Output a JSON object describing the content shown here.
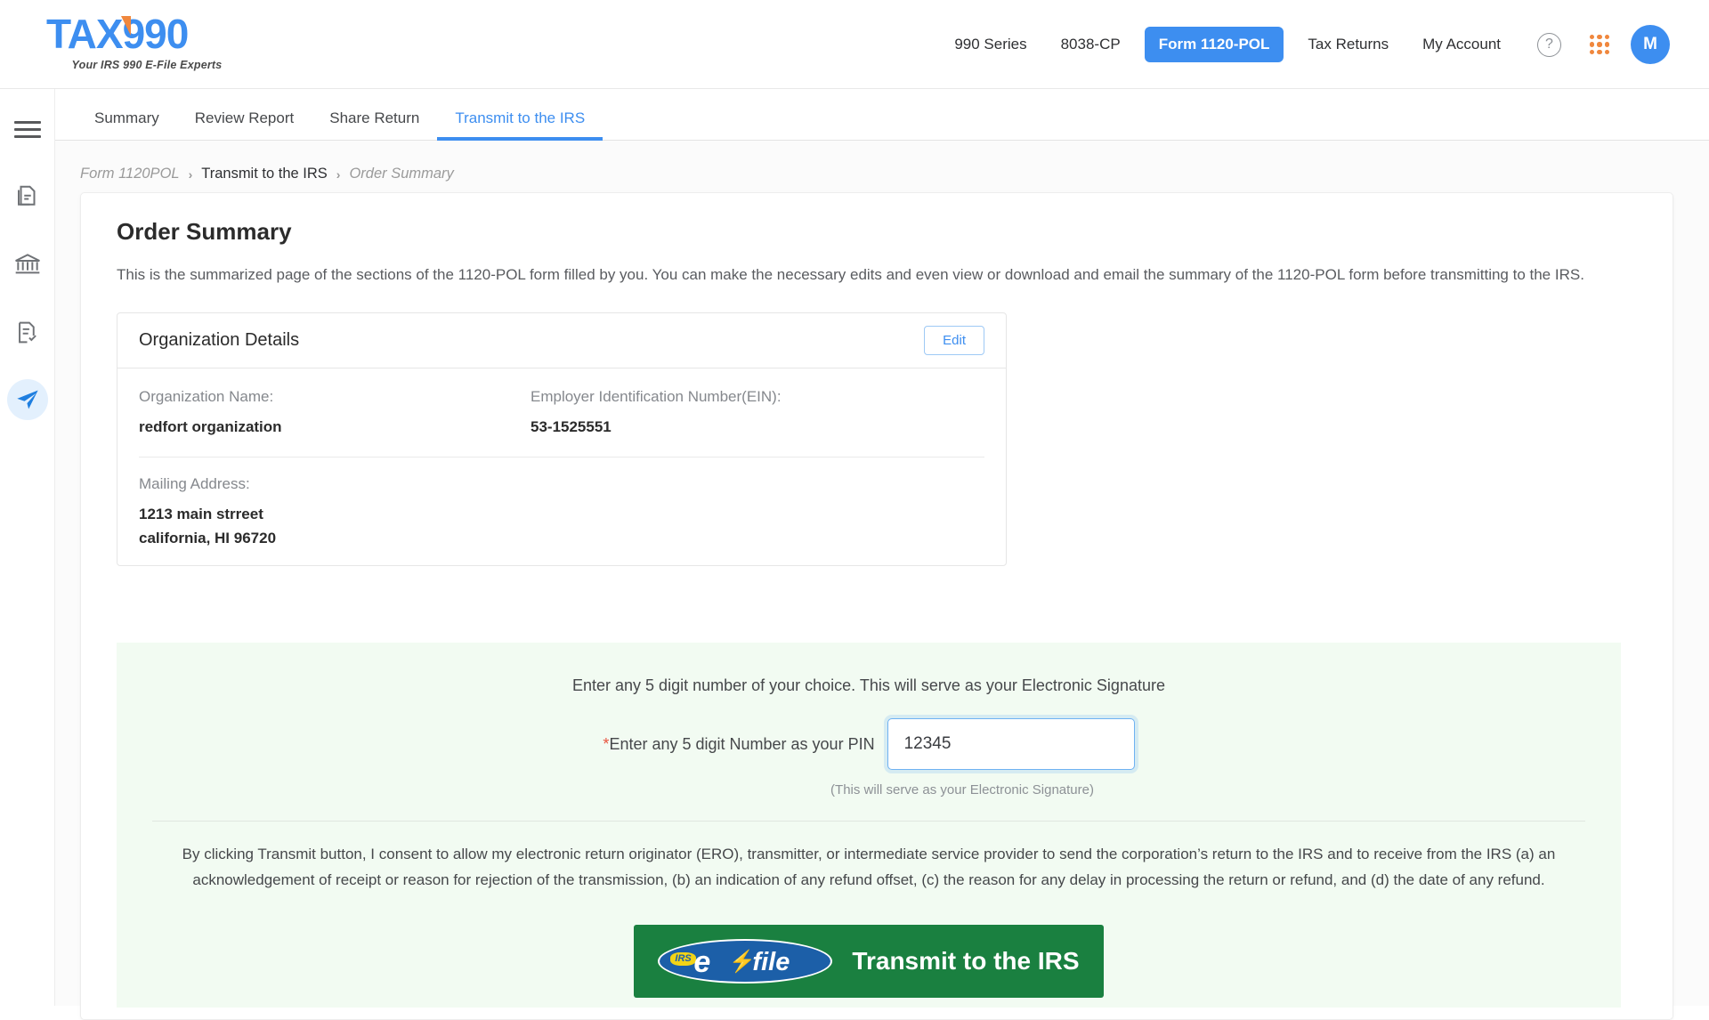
{
  "brand": {
    "logo_text": "TAX990",
    "logo_tagline": "Your IRS 990 E-File Experts"
  },
  "header": {
    "nav": [
      {
        "label": "990 Series",
        "active": false
      },
      {
        "label": "8038-CP",
        "active": false
      },
      {
        "label": "Form 1120-POL",
        "active": true
      },
      {
        "label": "Tax Returns",
        "active": false
      },
      {
        "label": "My Account",
        "active": false
      }
    ],
    "help_icon": "question-mark-circle-icon",
    "apps_icon": "apps-grid-icon",
    "avatar_initial": "M",
    "accent_blue": "#3d8ef0",
    "accent_orange": "#f0873d"
  },
  "sidebar": {
    "items": [
      {
        "icon": "hamburger-menu-icon",
        "active": false
      },
      {
        "icon": "documents-copy-icon",
        "active": false
      },
      {
        "icon": "bank-institution-icon",
        "active": false
      },
      {
        "icon": "document-check-icon",
        "active": false
      },
      {
        "icon": "paper-plane-send-icon",
        "active": true
      }
    ]
  },
  "tabs": [
    {
      "label": "Summary",
      "active": false
    },
    {
      "label": "Review Report",
      "active": false
    },
    {
      "label": "Share Return",
      "active": false
    },
    {
      "label": "Transmit to the IRS",
      "active": true
    }
  ],
  "breadcrumb": {
    "item1": "Form 1120POL",
    "sep1": "›",
    "item2": "Transmit to the IRS",
    "sep2": "›",
    "item3": "Order Summary"
  },
  "main": {
    "title": "Order Summary",
    "description": "This is the summarized page of the sections of the 1120-POL form filled by you. You can make the necessary edits and even view or download and email the summary of the 1120-POL form before transmitting to the IRS."
  },
  "organization_card": {
    "title": "Organization Details",
    "edit_label": "Edit",
    "fields": {
      "org_name_label": "Organization Name:",
      "org_name_value": "redfort organization",
      "ein_label": "Employer Identification Number(EIN):",
      "ein_value": "53-1525551",
      "address_label": "Mailing Address:",
      "address_line1": "1213 main strreet",
      "address_line2": "california, HI 96720"
    }
  },
  "signature": {
    "instruction": "Enter any 5 digit number of your choice. This will serve as your Electronic Signature",
    "pin_required_marker": "*",
    "pin_label": "Enter any 5 digit Number as your PIN",
    "pin_value": "12345",
    "pin_placeholder": "",
    "pin_helper": "(This will serve as your Electronic Signature)",
    "consent": "By clicking Transmit button, I consent to allow my electronic return originator (ERO), transmitter, or intermediate service provider to send the corporation’s return to the IRS and to receive from the IRS (a) an acknowledgement of receipt or reason for rejection of the transmission, (b) an indication of any refund offset, (c) the reason for any delay in processing the return or refund, and (d) the date of any refund.",
    "panel_color": "#f2fbf2"
  },
  "transmit_button": {
    "logo_irs": "IRS",
    "logo_e": "e",
    "logo_bolt": "⚡",
    "logo_file": "file",
    "label": "Transmit to the IRS",
    "color": "#1a8040"
  }
}
